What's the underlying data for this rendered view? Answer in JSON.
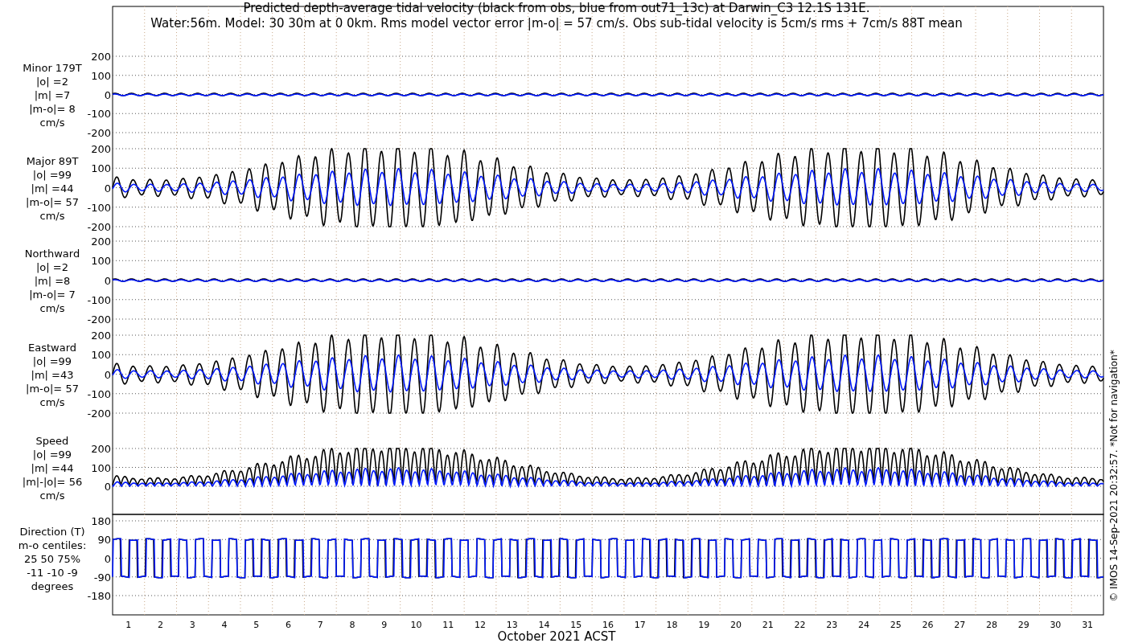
{
  "title": [
    "Predicted depth-average tidal velocity (black from obs, blue from out71_13c) at Darwin_C3 12.1S 131E.",
    "Water:56m. Model: 30 30m at 0 0km. Rms model vector error |m-o| = 57 cm/s. Obs sub-tidal velocity is 5cm/s rms + 7cm/s 88T mean"
  ],
  "panels": [
    {
      "kind": "weak",
      "label_lines": [
        "Minor 179T",
        "|o| =2",
        "|m| =7",
        "|m-o|= 8",
        "cm/s"
      ],
      "yticks": [
        "200",
        "100",
        "0",
        "-100",
        "-200"
      ]
    },
    {
      "kind": "strong",
      "label_lines": [
        "Major 89T",
        "|o| =99",
        "|m| =44",
        "|m-o|= 57",
        "cm/s"
      ],
      "yticks": [
        "200",
        "100",
        "0",
        "-100",
        "-200"
      ]
    },
    {
      "kind": "weak",
      "label_lines": [
        "Northward",
        "|o| =2",
        "|m| =8",
        "|m-o|= 7",
        "cm/s"
      ],
      "yticks": [
        "200",
        "100",
        "0",
        "-100",
        "-200"
      ]
    },
    {
      "kind": "strong",
      "label_lines": [
        "Eastward",
        "|o| =99",
        "|m| =43",
        "|m-o|= 57",
        "cm/s"
      ],
      "yticks": [
        "200",
        "100",
        "0",
        "-100",
        "-200"
      ]
    },
    {
      "kind": "speed",
      "label_lines": [
        "Speed",
        "|o| =99",
        "|m| =44",
        "|m|-|o|= 56",
        "cm/s"
      ],
      "yticks": [
        "200",
        "100",
        "0"
      ]
    },
    {
      "kind": "direction",
      "label_lines": [
        "Direction (T)",
        "m-o centiles:",
        "25  50  75%",
        "-11  -10   -9",
        "degrees"
      ],
      "yticks": [
        "180",
        "90",
        "0",
        "-90",
        "-180"
      ]
    }
  ],
  "xticks": [
    "1",
    "2",
    "3",
    "4",
    "5",
    "6",
    "7",
    "8",
    "9",
    "10",
    "11",
    "12",
    "13",
    "14",
    "15",
    "16",
    "17",
    "18",
    "19",
    "20",
    "21",
    "22",
    "23",
    "24",
    "25",
    "26",
    "27",
    "28",
    "29",
    "30",
    "31"
  ],
  "xlabel": "October 2021 ACST",
  "footer": "© IMOS 14-Sep-2021 20:32:57. *Not for navigation*"
}
